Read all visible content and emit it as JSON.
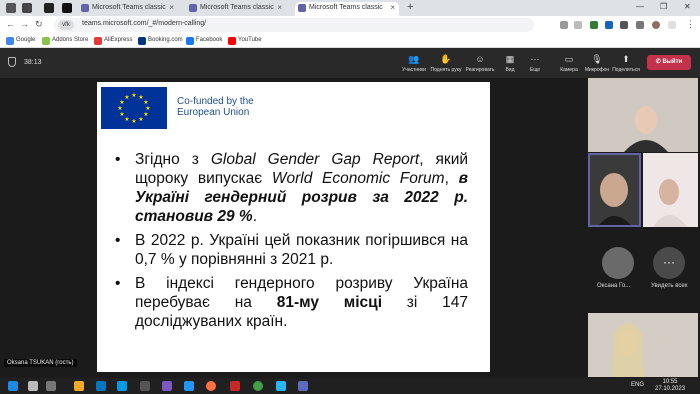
{
  "browser": {
    "tabs": [
      {
        "title": "Microsoft Teams classic",
        "active": false
      },
      {
        "title": "Microsoft Teams classic",
        "active": false
      },
      {
        "title": "Microsoft Teams classic",
        "active": true
      }
    ],
    "url": "teams.microsoft.com/_#/modern-calling/",
    "profile_badge": "vfk",
    "bookmarks": [
      "Google",
      "Addons Store",
      "AliExpress",
      "Booking.com",
      "Facebook",
      "YouTube"
    ]
  },
  "teams": {
    "timer": "38:13",
    "toolbar": [
      {
        "icon": "people-icon",
        "glyph": "👥",
        "label": "Участники"
      },
      {
        "icon": "raise-hand-icon",
        "glyph": "✋",
        "label": "Поднять руку"
      },
      {
        "icon": "react-icon",
        "glyph": "☺",
        "label": "Реагировать"
      },
      {
        "icon": "view-icon",
        "glyph": "▦",
        "label": "Вид"
      },
      {
        "icon": "more-icon",
        "glyph": "···",
        "label": "Еще"
      },
      {
        "icon": "camera-icon",
        "glyph": "▭",
        "label": "Камера"
      },
      {
        "icon": "microphone-icon",
        "glyph": "🎙",
        "label": "Микрофон"
      },
      {
        "icon": "share-icon",
        "glyph": "⬆",
        "label": "Поделиться"
      }
    ],
    "leave_label": "Выйти",
    "my_label": "Oksana TSUKAN (гость)",
    "participants": [
      {
        "name": "Оксана Го..."
      },
      {
        "name": "Увидеть всех"
      }
    ]
  },
  "slide": {
    "cofunded_line1": "Co-funded by the",
    "cofunded_line2": "European Union",
    "bullets": [
      [
        {
          "t": "Згідно з ",
          "s": "n"
        },
        {
          "t": "Global Gender Gap Report",
          "s": "i"
        },
        {
          "t": ", який щороку випускає ",
          "s": "n"
        },
        {
          "t": "World Economic Forum",
          "s": "i"
        },
        {
          "t": ", ",
          "s": "n"
        },
        {
          "t": "в Україні гендерний розрив за 2022 р. становив 29 %",
          "s": "bi"
        },
        {
          "t": ".",
          "s": "n"
        }
      ],
      [
        {
          "t": "В 2022 р. Україні цей показник погіршився на 0,7 % у порівнянні з 2021 р.",
          "s": "n"
        }
      ],
      [
        {
          "t": "В індексі гендерного розриву Україна перебуває на ",
          "s": "n"
        },
        {
          "t": "81-му місці",
          "s": "b"
        },
        {
          "t": " зі 147 досліджуваних країн.",
          "s": "n"
        }
      ]
    ]
  },
  "taskbar": {
    "lang": "ENG",
    "time": "10:55",
    "date": "27.10.2023"
  },
  "colors": {
    "leave": "#c4314b",
    "teams_bar": "#292929",
    "eu_blue": "#003399"
  }
}
